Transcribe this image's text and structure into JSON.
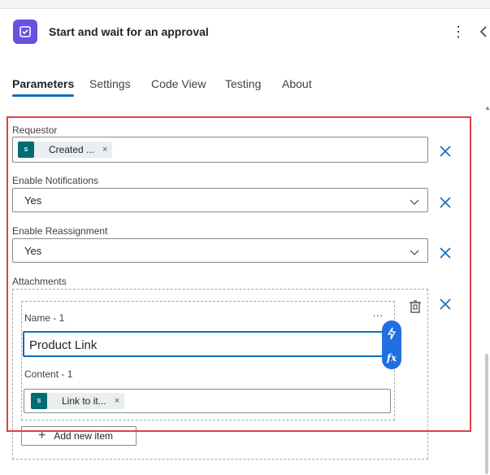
{
  "header": {
    "title": "Start and wait for an approval",
    "icon": "approval-icon",
    "more": "⋮",
    "collapse": "<"
  },
  "tabs": [
    {
      "label": "Parameters",
      "active": true
    },
    {
      "label": "Settings"
    },
    {
      "label": "Code View"
    },
    {
      "label": "Testing"
    },
    {
      "label": "About"
    }
  ],
  "form": {
    "requestor": {
      "label": "Requestor",
      "token": {
        "text": "Created ...",
        "icon": "sharepoint-icon",
        "close": "×"
      }
    },
    "enable_notifications": {
      "label": "Enable Notifications",
      "value": "Yes"
    },
    "enable_reassignment": {
      "label": "Enable Reassignment",
      "value": "Yes"
    },
    "attachments": {
      "label": "Attachments",
      "item": {
        "name_label": "Name - 1",
        "name_value": "Product Link",
        "content_label": "Content - 1",
        "content_token": {
          "text": "Link to it...",
          "icon": "sharepoint-icon",
          "close": "×"
        },
        "more": "…"
      },
      "add_label": "Add new item"
    }
  },
  "colors": {
    "accent": "#0f6cbd",
    "highlight": "#e04040",
    "app_icon": "#6a4fe0",
    "sharepoint": "#036c70",
    "dynamic_pill": "#1f6fe0"
  }
}
